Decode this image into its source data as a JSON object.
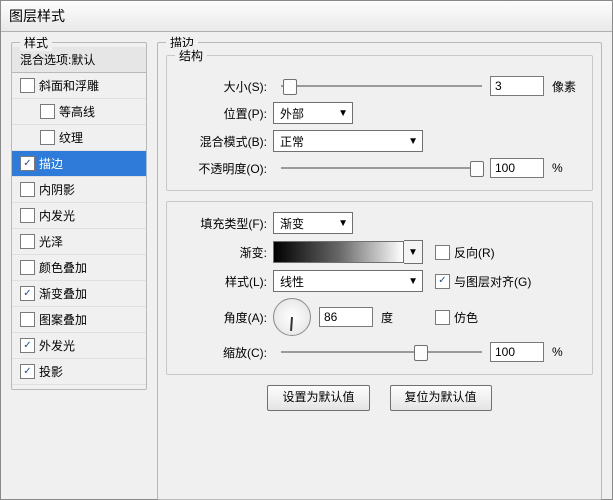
{
  "title": "图层样式",
  "left": {
    "heading": "样式",
    "blend_header": "混合选项:默认",
    "items": [
      {
        "label": "斜面和浮雕",
        "checked": false,
        "indent": false
      },
      {
        "label": "等高线",
        "checked": false,
        "indent": true
      },
      {
        "label": "纹理",
        "checked": false,
        "indent": true
      },
      {
        "label": "描边",
        "checked": true,
        "indent": false,
        "selected": true
      },
      {
        "label": "内阴影",
        "checked": false,
        "indent": false
      },
      {
        "label": "内发光",
        "checked": false,
        "indent": false
      },
      {
        "label": "光泽",
        "checked": false,
        "indent": false
      },
      {
        "label": "颜色叠加",
        "checked": false,
        "indent": false
      },
      {
        "label": "渐变叠加",
        "checked": true,
        "indent": false
      },
      {
        "label": "图案叠加",
        "checked": false,
        "indent": false
      },
      {
        "label": "外发光",
        "checked": true,
        "indent": false
      },
      {
        "label": "投影",
        "checked": true,
        "indent": false
      }
    ]
  },
  "stroke": {
    "group_label": "描边",
    "structure_label": "结构",
    "size_label": "大小(S):",
    "size_value": "3",
    "size_unit": "像素",
    "position_label": "位置(P):",
    "position_value": "外部",
    "blendmode_label": "混合模式(B):",
    "blendmode_value": "正常",
    "opacity_label": "不透明度(O):",
    "opacity_value": "100",
    "opacity_unit": "%",
    "filltype_label": "填充类型(F):",
    "filltype_value": "渐变",
    "gradient_label": "渐变:",
    "reverse_label": "反向(R)",
    "reverse_checked": false,
    "style_label": "样式(L):",
    "style_value": "线性",
    "align_label": "与图层对齐(G)",
    "align_checked": true,
    "angle_label": "角度(A):",
    "angle_value": "86",
    "angle_unit": "度",
    "dither_label": "仿色",
    "dither_checked": false,
    "scale_label": "缩放(C):",
    "scale_value": "100",
    "scale_unit": "%"
  },
  "buttons": {
    "make_default": "设置为默认值",
    "reset_default": "复位为默认值"
  }
}
